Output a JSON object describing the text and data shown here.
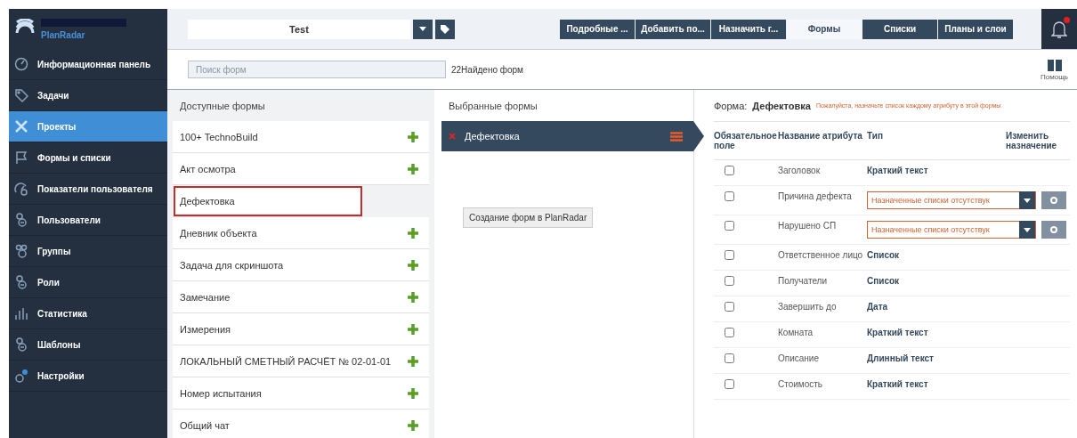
{
  "sidebar": {
    "logo": "PlanRadar",
    "items": [
      {
        "label": "Информационная панель",
        "selected": false
      },
      {
        "label": "Задачи",
        "selected": false
      },
      {
        "label": "Проекты",
        "selected": true
      },
      {
        "label": "Формы и списки",
        "selected": false
      },
      {
        "label": "Показатели пользователя",
        "selected": false
      },
      {
        "label": "Пользователи",
        "selected": false
      },
      {
        "label": "Группы",
        "selected": false
      },
      {
        "label": "Роли",
        "selected": false
      },
      {
        "label": "Статистика",
        "selected": false
      },
      {
        "label": "Шаблоны",
        "selected": false
      },
      {
        "label": "Настройки",
        "selected": false
      }
    ]
  },
  "topbar": {
    "project": "Test",
    "tabs": [
      {
        "label": "Подробные ...",
        "selected": false
      },
      {
        "label": "Добавить по...",
        "selected": false
      },
      {
        "label": "Назначить г...",
        "selected": false
      },
      {
        "label": "Формы",
        "selected": true
      },
      {
        "label": "Списки",
        "selected": false
      },
      {
        "label": "Планы и слои",
        "selected": false
      }
    ],
    "notification": true
  },
  "search": {
    "placeholder": "Поиск форм",
    "count": "22Найдено форм",
    "help": "Помощь"
  },
  "available": {
    "title": "Доступные формы",
    "items": [
      {
        "label": "100+ TechnoBuild",
        "highlighted": false
      },
      {
        "label": "Акт осмотра",
        "highlighted": false
      },
      {
        "label": "Дефектовка",
        "highlighted": true
      },
      {
        "label": "Дневник объекта",
        "highlighted": false
      },
      {
        "label": "Задача для скриншота",
        "highlighted": false
      },
      {
        "label": "Замечание",
        "highlighted": false
      },
      {
        "label": "Измерения",
        "highlighted": false
      },
      {
        "label": "ЛОКАЛЬНЫЙ СМЕТНЫЙ РАСЧЁТ № 02-01-01",
        "highlighted": false
      },
      {
        "label": "Номер испытания",
        "highlighted": false
      },
      {
        "label": "Общий чат",
        "highlighted": false
      }
    ]
  },
  "selected_forms": {
    "title": "Выбранные формы",
    "items": [
      {
        "label": "Дефектовка",
        "selected": true
      }
    ],
    "tooltip": "Создание форм в PlanRadar"
  },
  "form": {
    "label": "Форма:",
    "name": "Дефектовка",
    "warning": "Пожалуйста, назначьте список каждому атрибуту в этой формы",
    "columns": [
      "Обязательное поле",
      "Название атрибута",
      "Тип",
      "Изменить назначение"
    ],
    "rows": [
      {
        "checked": false,
        "name": "Заголовок",
        "kind": "text",
        "type": "Краткий текст"
      },
      {
        "checked": false,
        "name": "Причина дефекта",
        "kind": "select",
        "type": "Назначенные списки отсутствук"
      },
      {
        "checked": false,
        "name": "Нарушено СП",
        "kind": "select",
        "type": "Назначенные списки отсутствук"
      },
      {
        "checked": false,
        "name": "Ответственное лицо",
        "kind": "text",
        "type": "Список"
      },
      {
        "checked": false,
        "name": "Получатели",
        "kind": "text",
        "type": "Список"
      },
      {
        "checked": false,
        "name": "Завершить до",
        "kind": "text",
        "type": "Дата"
      },
      {
        "checked": false,
        "name": "Комната",
        "kind": "text",
        "type": "Краткий текст"
      },
      {
        "checked": false,
        "name": "Описание",
        "kind": "text",
        "type": "Длинный текст"
      },
      {
        "checked": false,
        "name": "Стоимость",
        "kind": "text",
        "type": "Краткий текст"
      }
    ]
  }
}
